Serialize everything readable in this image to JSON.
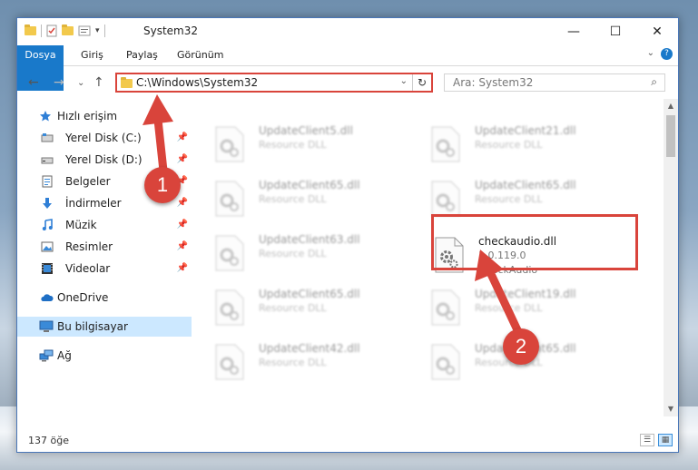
{
  "window": {
    "title": "System32",
    "controls": {
      "minimize": "—",
      "maximize": "☐",
      "close": "✕"
    }
  },
  "ribbon": {
    "tabs": [
      "Dosya",
      "Giriş",
      "Paylaş",
      "Görünüm"
    ],
    "expand_glyph": "⌄",
    "help_glyph": "?"
  },
  "address_bar": {
    "path": "C:\\Windows\\System32",
    "search_placeholder": "Ara: System32"
  },
  "nav_glyphs": {
    "back": "←",
    "forward": "→",
    "recent": "⌄",
    "up": "↑",
    "refresh": "↻",
    "search": "⌕",
    "pin": "📌"
  },
  "nav_pane": {
    "quick_access": "Hızlı erişim",
    "items": [
      {
        "label": "Yerel Disk (C:)",
        "icon": "drive-icon"
      },
      {
        "label": "Yerel Disk (D:)",
        "icon": "drive-icon"
      },
      {
        "label": "Belgeler",
        "icon": "documents-icon"
      },
      {
        "label": "İndirmeler",
        "icon": "downloads-icon"
      },
      {
        "label": "Müzik",
        "icon": "music-icon"
      },
      {
        "label": "Resimler",
        "icon": "pictures-icon"
      },
      {
        "label": "Videolar",
        "icon": "videos-icon"
      }
    ],
    "onedrive": "OneDrive",
    "this_pc": "Bu bilgisayar",
    "network": "Ağ"
  },
  "files": [
    {
      "name": "UpdateClient5.dll",
      "type": "Resource DLL"
    },
    {
      "name": "UpdateClient21.dll",
      "type": "Resource DLL"
    },
    {
      "name": "UpdateClient65.dll",
      "type": "Resource DLL"
    },
    {
      "name": "UpdateClient65.dll",
      "type": "Resource DLL"
    },
    {
      "name": "UpdateClient63.dll",
      "type": "Resource DLL"
    },
    {
      "name": "checkaudio.dll",
      "version": "1.0.119.0",
      "description": "CheckAudio"
    },
    {
      "name": "UpdateClient65.dll",
      "type": "Resource DLL"
    },
    {
      "name": "UpdateClient19.dll",
      "type": "Resource DLL"
    },
    {
      "name": "UpdateClient42.dll",
      "type": "Resource DLL"
    },
    {
      "name": "UpdateClient65.dll",
      "type": "Resource DLL"
    }
  ],
  "status": {
    "item_count": "137 öğe"
  },
  "annotations": {
    "step1": "1",
    "step2": "2"
  },
  "colors": {
    "accent": "#1979ca",
    "highlight_red": "#d9443b",
    "selection": "#cce8ff"
  }
}
